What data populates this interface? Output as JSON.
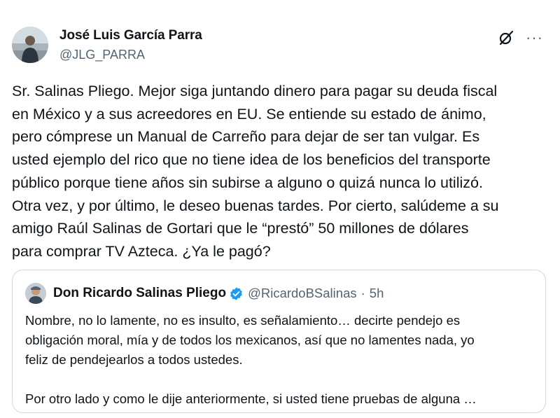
{
  "tweet": {
    "author": {
      "name": "José Luis García Parra",
      "handle": "@JLG_PARRA"
    },
    "icons": {
      "grok": "grok-icon",
      "more": "more-icon",
      "more_glyph": "···"
    },
    "text": "Sr. Salinas Pliego. Mejor siga juntando dinero para pagar su deuda fiscal\nen México y a sus acreedores en EU. Se entiende su estado de ánimo,\npero cómprese un Manual de Carreño para dejar de ser tan vulgar. Es\nusted ejemplo del rico que no tiene idea de los beneficios del transporte\npúblico porque tiene años sin subirse a alguno o quizá nunca lo utilizó.\nOtra vez, y por último, le deseo buenas tardes. Por cierto, salúdeme a su\namigo Raúl Salinas de Gortari que le “prestó” 50 millones de dólares\npara comprar TV Azteca. ¿Ya le pagó?"
  },
  "quote": {
    "author": {
      "name": "Don Ricardo Salinas Pliego",
      "handle": "@RicardoBSalinas",
      "verified": true
    },
    "separator": "·",
    "time": "5h",
    "text": "Nombre, no lo lamente, no es insulto, es señalamiento… decirte pendejo es\nobligación moral, mía y de todos los mexicanos, así que no lamentes nada, yo\nfeliz de pendejearlos a todos ustedes.\n\nPor otro lado y como le dije anteriormente, si usted tiene pruebas de alguna …"
  },
  "colors": {
    "text": "#0f1419",
    "secondary": "#536471",
    "border": "#cfd9de",
    "verified": "#1d9bf0"
  }
}
